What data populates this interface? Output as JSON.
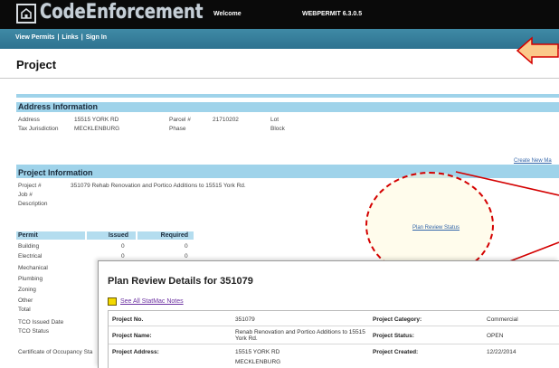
{
  "header": {
    "brand": "CodeEnforcement",
    "welcome": "Welcome",
    "version": "WEBPERMIT 6.3.0.5"
  },
  "nav": {
    "view_permits": "View Permits",
    "links": "Links",
    "sign_in": "Sign In",
    "separator": "|"
  },
  "page": {
    "title": "Project"
  },
  "address": {
    "heading": "Address Information",
    "address_label": "Address",
    "address_value": "15515 YORK RD",
    "jurisdiction_label": "Tax Jurisdiction",
    "jurisdiction_value": "MECKLENBURG",
    "parcel_label": "Parcel #",
    "parcel_value": "21710202",
    "phase_label": "Phase",
    "lot_label": "Lot",
    "block_label": "Block"
  },
  "project": {
    "heading": "Project Information",
    "create_link": "Create New Ma",
    "project_label": "Project #",
    "project_value": "351079 Rehab Renovation and Portico Additions to 15515 York Rd.",
    "job_label": "Job #",
    "description_label": "Description",
    "plan_review_link": "Plan Review Status"
  },
  "permits": {
    "col_permit": "Permit",
    "col_issued": "Issued",
    "col_required": "Required",
    "rows": [
      {
        "name": "Building",
        "issued": "0",
        "required": "0"
      },
      {
        "name": "Electrical",
        "issued": "0",
        "required": "0"
      },
      {
        "name": "Mechanical",
        "issued": "",
        "required": ""
      },
      {
        "name": "Plumbing",
        "issued": "",
        "required": ""
      },
      {
        "name": "Zoning",
        "issued": "",
        "required": ""
      },
      {
        "name": "Other",
        "issued": "",
        "required": ""
      },
      {
        "name": "Total",
        "issued": "",
        "required": ""
      }
    ],
    "tco_issued": "TCO Issued Date",
    "tco_status": "TCO Status",
    "cert_occupancy": "Certificate of Occupancy Sta"
  },
  "popup": {
    "title": "Plan Review Details for 351079",
    "notes_link": "See All StatMac Notes",
    "project_no_label": "Project No.",
    "project_no_value": "351079",
    "project_name_label": "Project Name:",
    "project_name_value": "Renab Renovation and Portico Additions to 15515 York Rd.",
    "project_address_label": "Project Address:",
    "project_address_value": "15515 YORK RD",
    "project_address_value2": "MECKLENBURG",
    "category_label": "Project Category:",
    "category_value": "Commercial",
    "status_label": "Project Status:",
    "status_value": "OPEN",
    "created_label": "Project Created:",
    "created_value": "12/22/2014"
  },
  "colors": {
    "topbar": "#0a0a0a",
    "navbar": "#3380a0",
    "section_header": "#9fd3ea",
    "annotation_red": "#d40000",
    "arrow_fill": "#fbc98a"
  }
}
